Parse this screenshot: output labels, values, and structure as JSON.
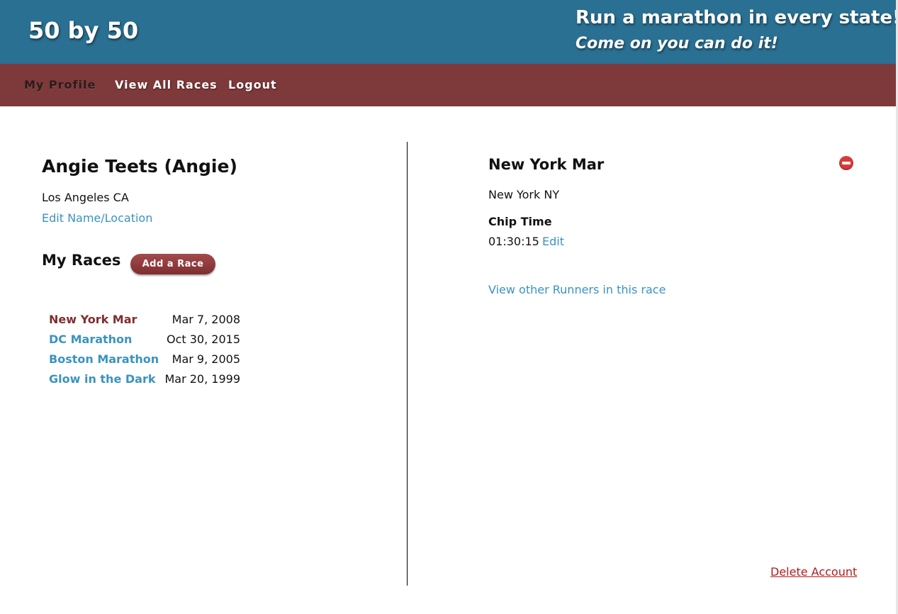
{
  "header": {
    "logo": "50 by 50",
    "tagline_primary": "Run a marathon in every state!",
    "tagline_secondary": "Come on you can do it!"
  },
  "nav": {
    "items": [
      {
        "label": "My Profile",
        "active": true
      },
      {
        "label": "View All Races",
        "active": false
      },
      {
        "label": "Logout",
        "active": false
      }
    ]
  },
  "profile": {
    "name": "Angie Teets (Angie)",
    "location": "Los Angeles CA",
    "edit_link": "Edit Name/Location"
  },
  "races": {
    "title": "My Races",
    "add_button": "Add a Race",
    "items": [
      {
        "name": "New York Mar",
        "date": "Mar 7, 2008",
        "selected": true
      },
      {
        "name": "DC Marathon",
        "date": "Oct 30, 2015",
        "selected": false
      },
      {
        "name": "Boston Marathon",
        "date": "Mar 9, 2005",
        "selected": false
      },
      {
        "name": "Glow in the Dark",
        "date": "Mar 20, 1999",
        "selected": false
      }
    ]
  },
  "race_detail": {
    "title": "New York Mar",
    "location": "New York NY",
    "chip_time_label": "Chip Time",
    "chip_time_value": "01:30:15",
    "edit_link": "Edit",
    "view_runners_link": "View other Runners in this race",
    "remove_icon": "remove-circle-icon"
  },
  "footer": {
    "delete_account": "Delete Account"
  },
  "colors": {
    "header_bg": "#2a7092",
    "nav_bg": "#7e393a",
    "link": "#3a93be",
    "selected_race": "#7e2e30",
    "danger": "#b31b1b"
  }
}
